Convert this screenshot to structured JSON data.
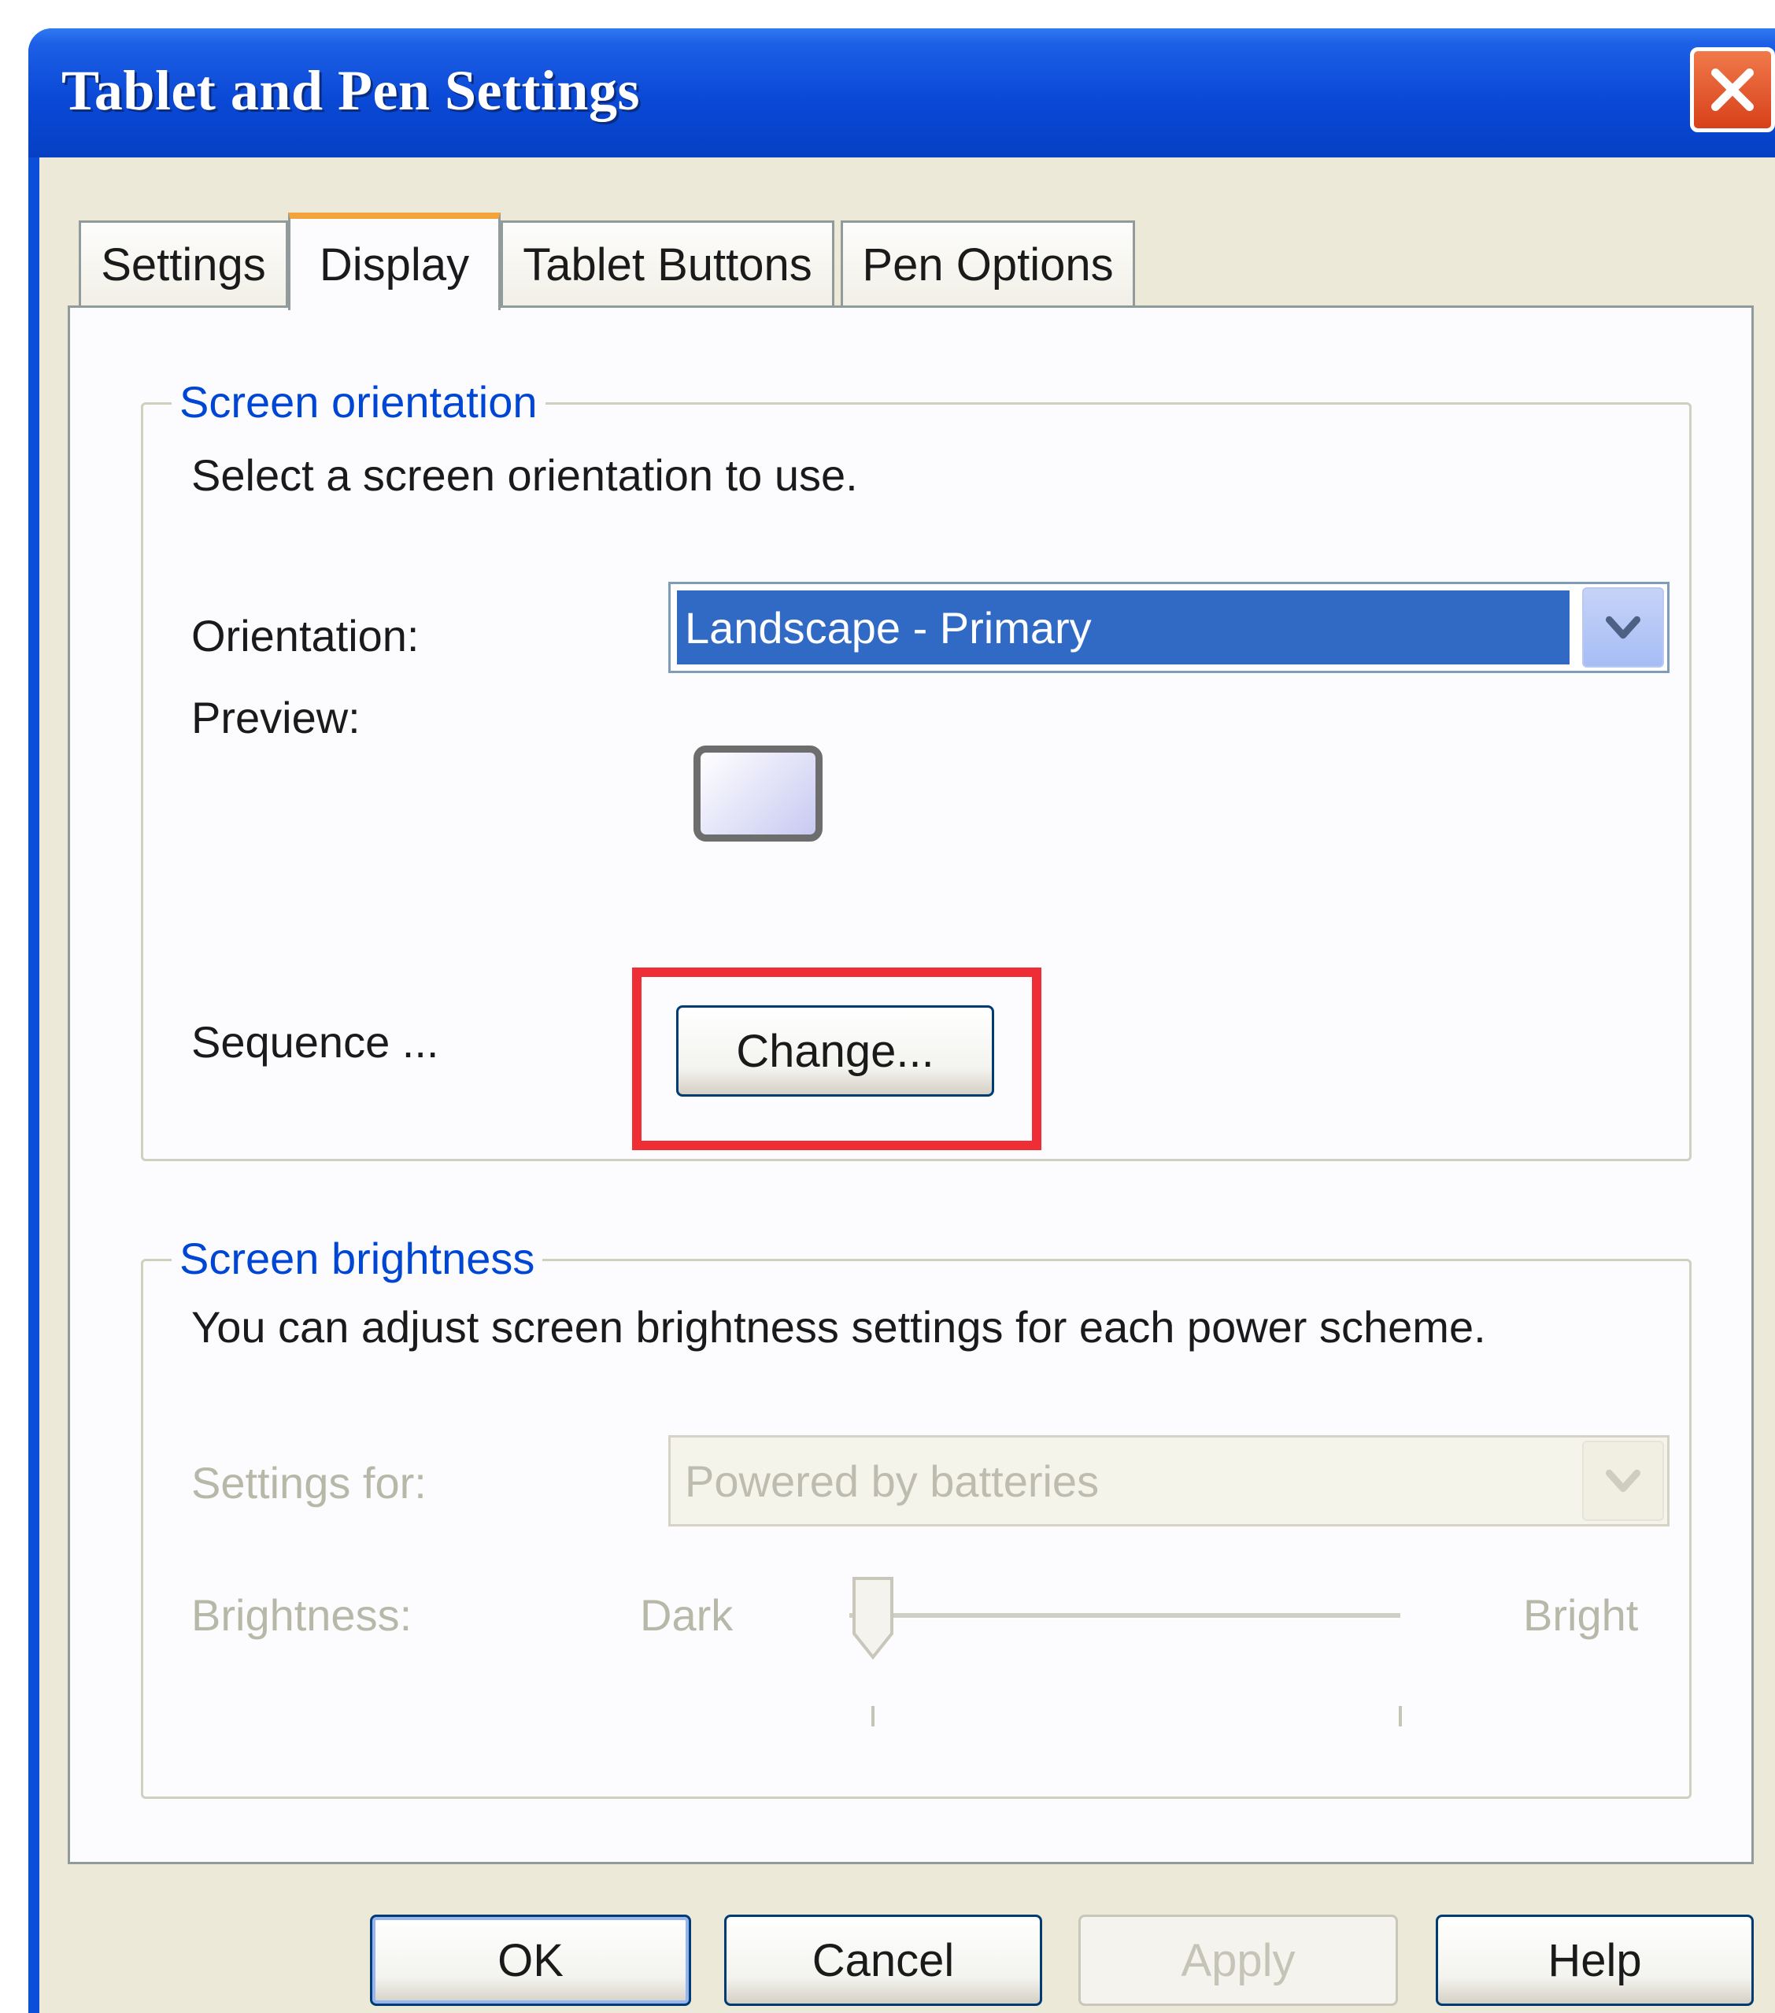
{
  "window": {
    "title": "Tablet and Pen Settings"
  },
  "tabs": [
    {
      "label": "Settings",
      "active": false
    },
    {
      "label": "Display",
      "active": true
    },
    {
      "label": "Tablet Buttons",
      "active": false
    },
    {
      "label": "Pen Options",
      "active": false
    }
  ],
  "orientation_group": {
    "title": "Screen orientation",
    "description": "Select a screen orientation to use.",
    "orientation_label": "Orientation:",
    "orientation_value": "Landscape - Primary",
    "preview_label": "Preview:",
    "sequence_label": "Sequence ...",
    "change_button": "Change..."
  },
  "brightness_group": {
    "title": "Screen brightness",
    "description": "You can adjust screen brightness settings for each power scheme.",
    "settings_for_label": "Settings for:",
    "settings_for_value": "Powered by batteries",
    "brightness_label": "Brightness:",
    "dark_label": "Dark",
    "bright_label": "Bright",
    "brightness_level": 0
  },
  "buttons": {
    "ok": "OK",
    "cancel": "Cancel",
    "apply": "Apply",
    "help": "Help"
  },
  "colors": {
    "titlebar": "#0a49d6",
    "accent_group_title": "#0046d5",
    "selection": "#316ac5",
    "highlight_box": "#ee2e34",
    "active_tab_top": "#f2a33a"
  },
  "icons": {
    "close": "close-x-icon",
    "dropdown": "chevron-down-icon",
    "slider": "slider-thumb-icon"
  }
}
